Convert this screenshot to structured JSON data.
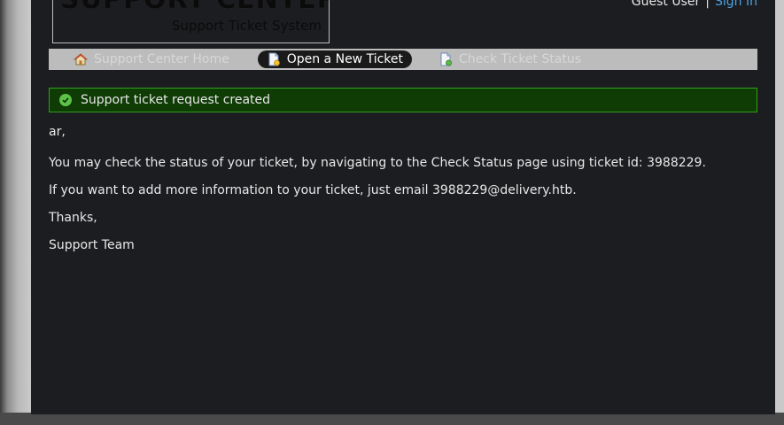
{
  "logo": {
    "title": "SUPPORT CENTER",
    "subtitle": "Support Ticket System"
  },
  "userbar": {
    "guest_label": "Guest User",
    "separator": "|",
    "signin_label": "Sign In"
  },
  "nav": {
    "items": [
      {
        "label": "Support Center Home",
        "icon": "home-icon",
        "active": false
      },
      {
        "label": "Open a New Ticket",
        "icon": "new-ticket-icon",
        "active": true
      },
      {
        "label": "Check Ticket Status",
        "icon": "ticket-status-icon",
        "active": false
      }
    ]
  },
  "alert": {
    "message": "Support ticket request created",
    "icon": "check-circle-icon",
    "color": "#2ea11a"
  },
  "content": {
    "greeting": "ar,",
    "status_line": "You may check the status of your ticket, by navigating to the Check Status page using ticket id: 3988229.",
    "email_line": "If you want to add more information to your ticket, just email 3988229@delivery.htb.",
    "thanks": "Thanks,",
    "signature": "Support Team"
  },
  "colors": {
    "background": "#1c1d20",
    "nav_bar": "#bcbcbc",
    "link": "#4ba3e3",
    "alert_bg": "#0f3b05"
  }
}
